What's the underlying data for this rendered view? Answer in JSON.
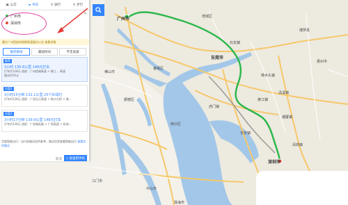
{
  "panel": {
    "modes": [
      {
        "label": "公交",
        "icon": "bus-icon"
      },
      {
        "label": "驾车",
        "icon": "car-icon"
      },
      {
        "label": "骑行",
        "icon": "bike-icon"
      },
      {
        "label": "步行",
        "icon": "walk-icon"
      }
    ],
    "active_mode": 1,
    "origin": "广州市",
    "destination": "深圳市",
    "notice": "遇大广州西部的假期高速路况公告  查看详情",
    "tabs": [
      "推荐路线",
      "最短时间",
      "不走高速"
    ],
    "routes": [
      {
        "badge": "推荐",
        "summary": "3小时   136.8公里   148元打车",
        "detail": "打车约128元  途经：广州绕城高速 > 珠江... 高速",
        "extra": "路况约50元"
      },
      {
        "badge": "方案2",
        "summary": "3小时15分钟   132.1公里   25个红绿灯",
        "detail": "打车约128元  途经：广深沿江高速 > 南沙大桥 > 珠...",
        "extra": ""
      },
      {
        "badge": "方案3",
        "summary": "3小时17分钟   139.9公里   148元打车",
        "detail": "打车约128元  途经：广深城际路 > 广深高速 > 机场...",
        "extra": ""
      }
    ],
    "footer_text": "百度智能出行：出行前路况仅供参考，路况信息查看智能出行",
    "footer_link": "查看实时路况",
    "cancel": "取消",
    "send_button": "发送到手机"
  },
  "map": {
    "cities": [
      "广州市",
      "东莞市",
      "佛山市",
      "深圳市",
      "中山市",
      "江门市",
      "珠海市",
      "顺德区",
      "番禺区",
      "南沙区",
      "虎门镇",
      "长安镇",
      "石龙镇",
      "增城区",
      "惠州市",
      "博罗县",
      "清溪镇",
      "塘厦镇",
      "凤岗镇",
      "黄江镇",
      "樟木头镇"
    ],
    "route_color": "#2db84d",
    "water_color": "#a3c7e8"
  }
}
